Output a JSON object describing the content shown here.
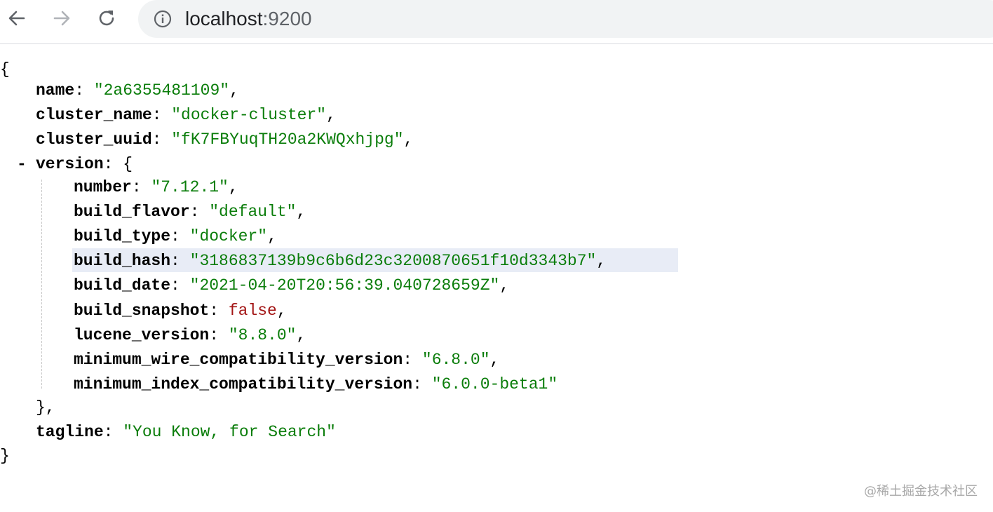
{
  "browser": {
    "url_host": "localhost",
    "url_port": ":9200",
    "icons": {
      "back": "back-arrow-icon",
      "forward": "forward-arrow-icon",
      "reload": "reload-icon",
      "site_info": "info-icon"
    }
  },
  "json": {
    "open_brace": "{",
    "close_brace": "}",
    "collapse_symbol": "-",
    "fields": {
      "name": {
        "key": "name",
        "value": "\"2a6355481109\""
      },
      "cluster_name": {
        "key": "cluster_name",
        "value": "\"docker-cluster\""
      },
      "cluster_uuid": {
        "key": "cluster_uuid",
        "value": "\"fK7FBYuqTH20a2KWQxhjpg\""
      },
      "version": {
        "key": "version",
        "open": "{",
        "close": "},"
      },
      "tagline": {
        "key": "tagline",
        "value": "\"You Know, for Search\""
      }
    },
    "version_fields": [
      {
        "key": "number",
        "value": "\"7.12.1\"",
        "type": "string",
        "comma": ","
      },
      {
        "key": "build_flavor",
        "value": "\"default\"",
        "type": "string",
        "comma": ","
      },
      {
        "key": "build_type",
        "value": "\"docker\"",
        "type": "string",
        "comma": ","
      },
      {
        "key": "build_hash",
        "value": "\"3186837139b9c6b6d23c3200870651f10d3343b7\"",
        "type": "string",
        "comma": ","
      },
      {
        "key": "build_date",
        "value": "\"2021-04-20T20:56:39.040728659Z\"",
        "type": "string",
        "comma": ","
      },
      {
        "key": "build_snapshot",
        "value": "false",
        "type": "boolean",
        "comma": ","
      },
      {
        "key": "lucene_version",
        "value": "\"8.8.0\"",
        "type": "string",
        "comma": ","
      },
      {
        "key": "minimum_wire_compatibility_version",
        "value": "\"6.8.0\"",
        "type": "string",
        "comma": ","
      },
      {
        "key": "minimum_index_compatibility_version",
        "value": "\"6.0.0-beta1\"",
        "type": "string",
        "comma": ""
      }
    ],
    "highlighted_key": "build_hash"
  },
  "colors": {
    "string": "#0a7d0a",
    "boolean": "#a31515",
    "highlight": "#e8ecf6"
  },
  "watermark": "@稀土掘金技术社区"
}
